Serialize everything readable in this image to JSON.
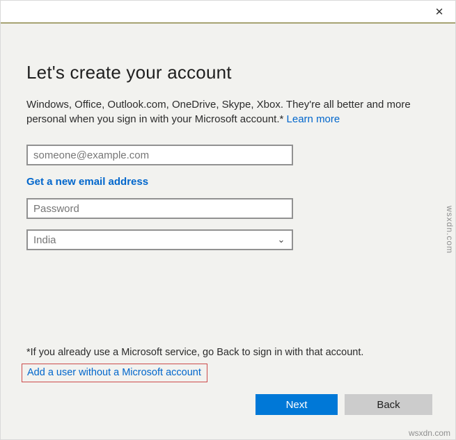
{
  "window": {
    "title": "Let's create your account"
  },
  "icons": {
    "close_glyph": "✕",
    "chevron_down_glyph": "⌄"
  },
  "dialog": {
    "title": "Let's create your account",
    "description": "Windows, Office, Outlook.com, OneDrive, Skype, Xbox. They're all better and more personal when you sign in with your Microsoft account.* ",
    "learn_more_label": "Learn more",
    "email_placeholder": "someone@example.com",
    "new_email_link_label": "Get a new email address",
    "password_placeholder": "Password",
    "country_selected": "India",
    "footnote": "*If you already use a Microsoft service, go Back to sign in with that account.",
    "add_local_user_link_label": "Add a user without a Microsoft account",
    "next_label": "Next",
    "back_label": "Back"
  },
  "watermark": {
    "text": "wsxdn.com"
  },
  "colors": {
    "accent": "#0078d7",
    "link": "#0066cc",
    "annotation_red": "#cc4b4b",
    "body_background": "#f2f2ef"
  }
}
